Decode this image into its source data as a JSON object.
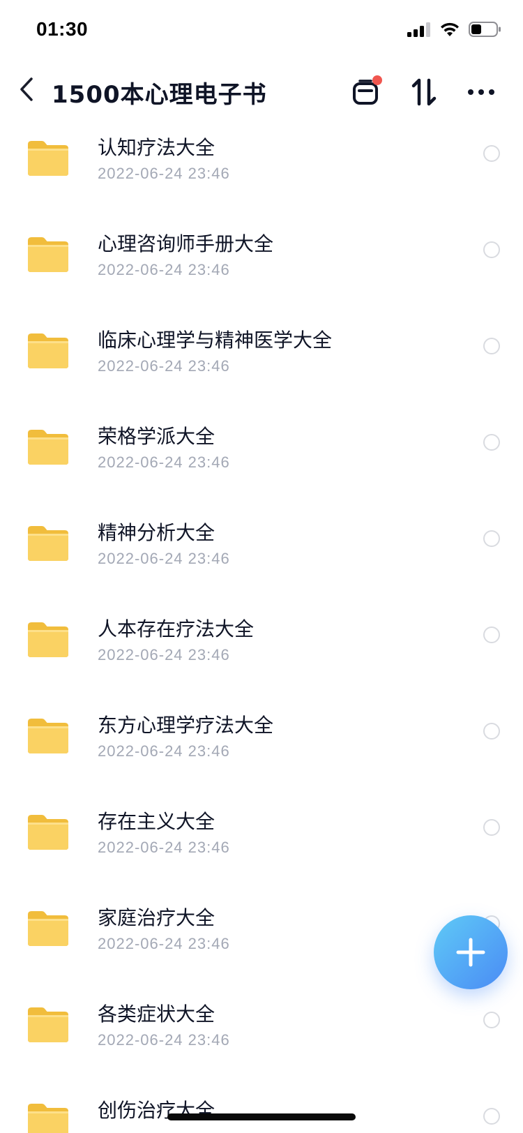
{
  "status_bar": {
    "time": "01:30"
  },
  "header": {
    "title": "1500本心理电子书",
    "back_icon": "chevron-left-icon",
    "transfer_icon": "transfer-list-icon",
    "sort_icon": "sort-icon",
    "more_icon": "more-dots-icon",
    "notification_dot_color": "#f0564f"
  },
  "folders": [
    {
      "name": "认知疗法大全",
      "date": "2022-06-24 23:46"
    },
    {
      "name": "心理咨询师手册大全",
      "date": "2022-06-24 23:46"
    },
    {
      "name": "临床心理学与精神医学大全",
      "date": "2022-06-24 23:46"
    },
    {
      "name": "荣格学派大全",
      "date": "2022-06-24 23:46"
    },
    {
      "name": "精神分析大全",
      "date": "2022-06-24 23:46"
    },
    {
      "name": "人本存在疗法大全",
      "date": "2022-06-24 23:46"
    },
    {
      "name": "东方心理学疗法大全",
      "date": "2022-06-24 23:46"
    },
    {
      "name": "存在主义大全",
      "date": "2022-06-24 23:46"
    },
    {
      "name": "家庭治疗大全",
      "date": "2022-06-24 23:46"
    },
    {
      "name": "各类症状大全",
      "date": "2022-06-24 23:46"
    },
    {
      "name": "创伤治疗大全",
      "date": ""
    }
  ],
  "fab": {
    "icon": "plus-icon",
    "gradient_start": "#5fcaf6",
    "gradient_end": "#4a8bf5"
  },
  "colors": {
    "folder": "#f9cf52",
    "title_text": "#0f1426",
    "date_text": "#a3a8b5"
  }
}
